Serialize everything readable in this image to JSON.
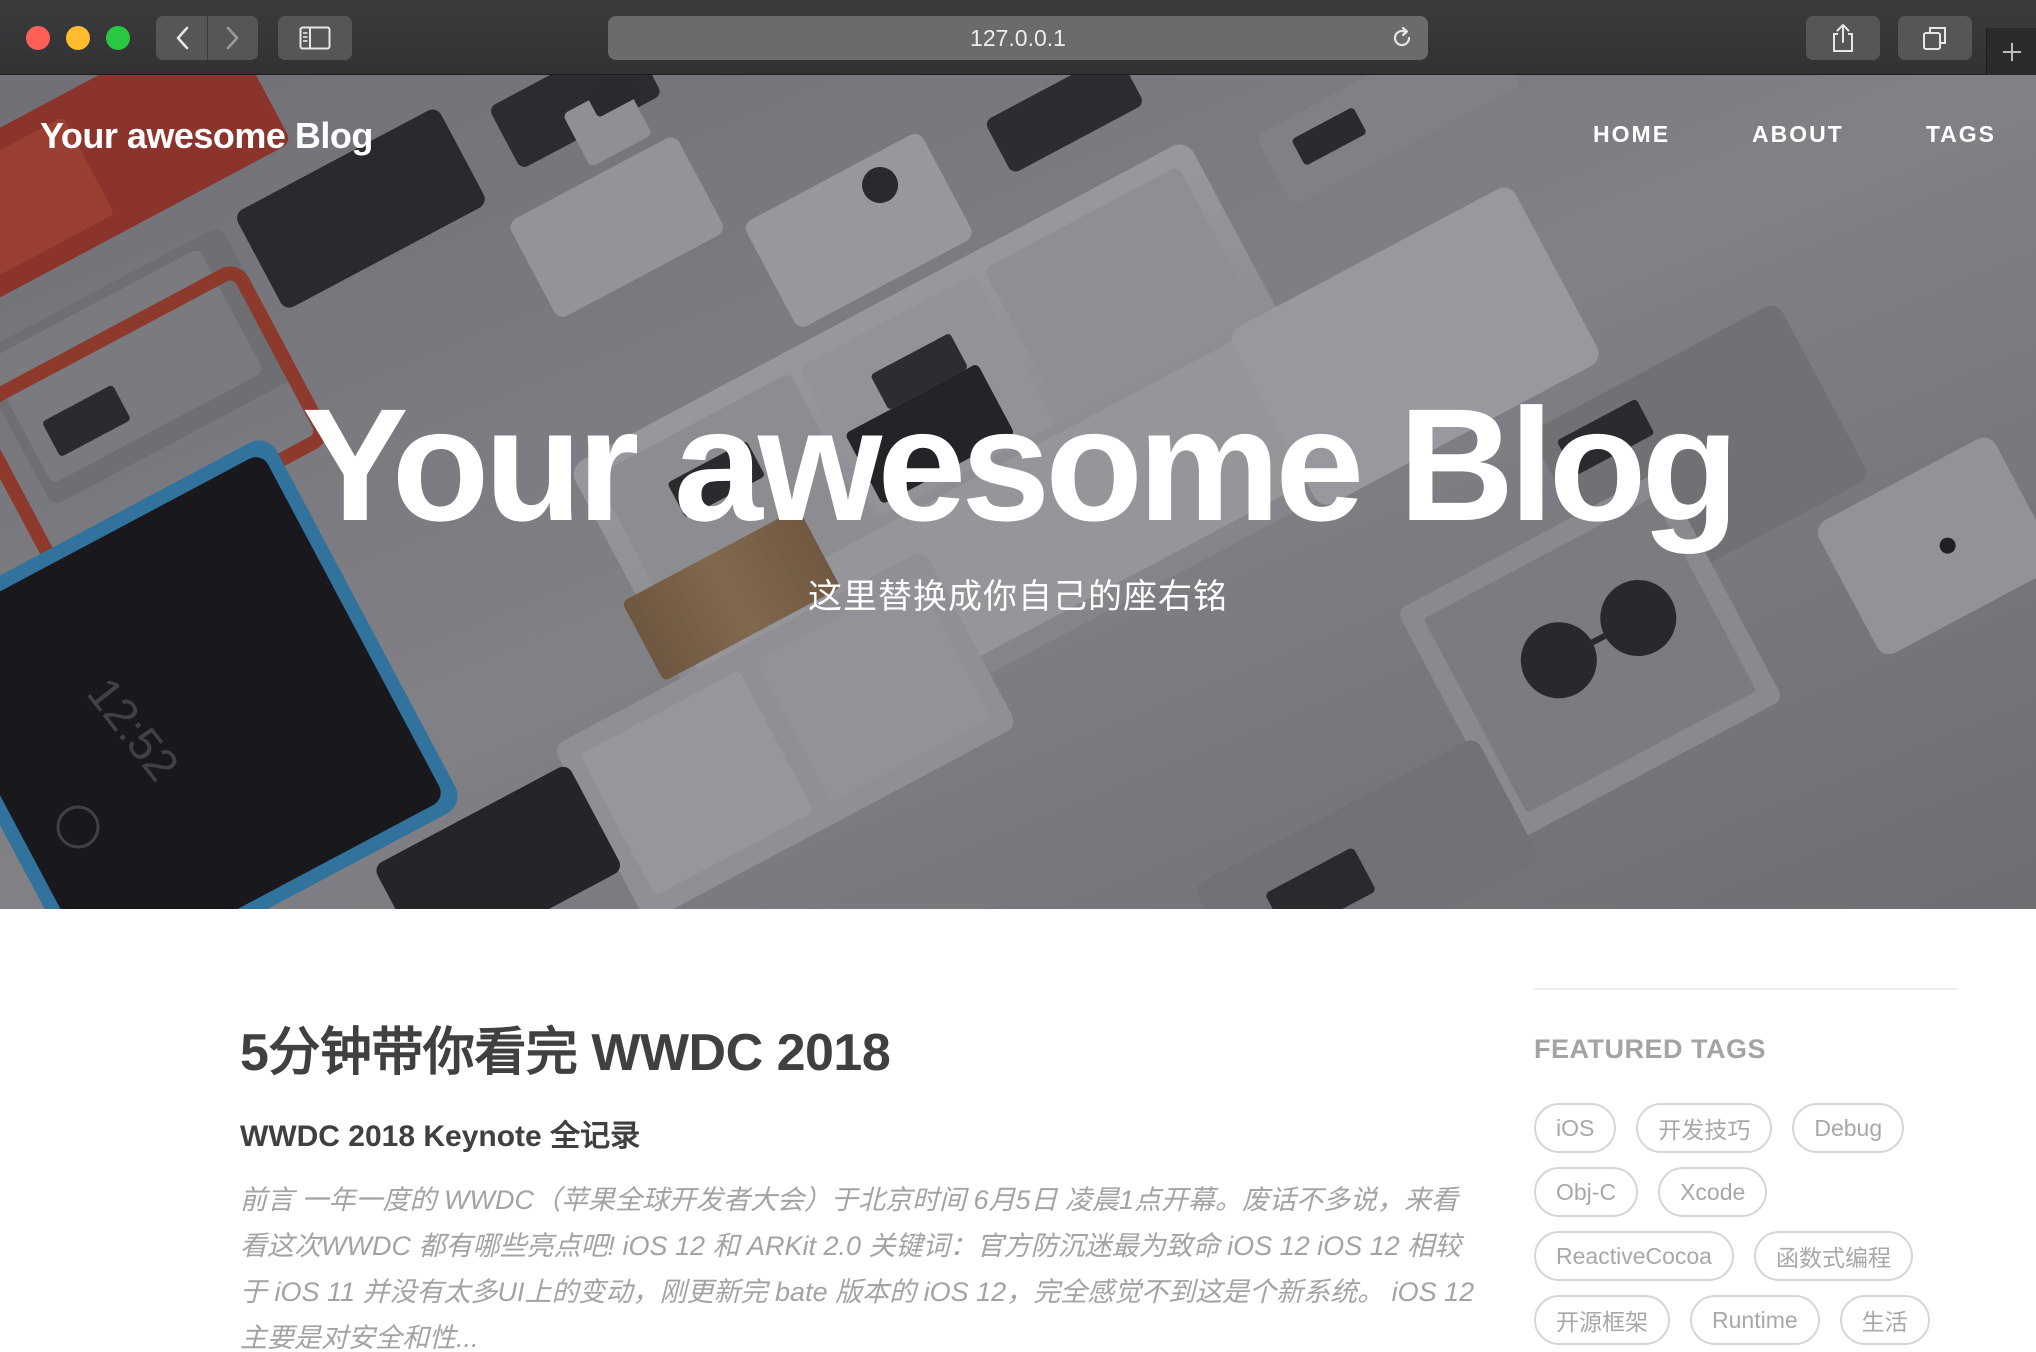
{
  "browser": {
    "url": "127.0.0.1"
  },
  "site": {
    "brand": "Your awesome Blog",
    "nav": [
      {
        "label": "HOME"
      },
      {
        "label": "ABOUT"
      },
      {
        "label": "TAGS"
      }
    ]
  },
  "hero": {
    "title": "Your awesome Blog",
    "subtitle": "这里替换成你自己的座右铭",
    "phone_clock": "12:52"
  },
  "post": {
    "title": "5分钟带你看完 WWDC 2018",
    "subtitle": "WWDC 2018 Keynote 全记录",
    "excerpt": "前言 一年一度的 WWDC（苹果全球开发者大会）于北京时间 6月5日 凌晨1点开幕。废话不多说，来看看这次WWDC 都有哪些亮点吧! iOS 12 和 ARKit 2.0 关键词：官方防沉迷最为致命 iOS 12 iOS 12 相较于 iOS 11 并没有太多UI上的变动，刚更新完 bate 版本的 iOS 12，完全感觉不到这是个新系统。 iOS 12 主要是对安全和性..."
  },
  "sidebar": {
    "heading": "FEATURED TAGS",
    "tags": [
      "iOS",
      "开发技巧",
      "Debug",
      "Obj-C",
      "Xcode",
      "ReactiveCocoa",
      "函数式编程",
      "开源框架",
      "Runtime",
      "生活"
    ]
  },
  "colors": {
    "chrome": "#3b3b3d",
    "text_dark": "#404040",
    "text_muted": "#a3a3a3",
    "tag_border": "#d6d6d6"
  }
}
